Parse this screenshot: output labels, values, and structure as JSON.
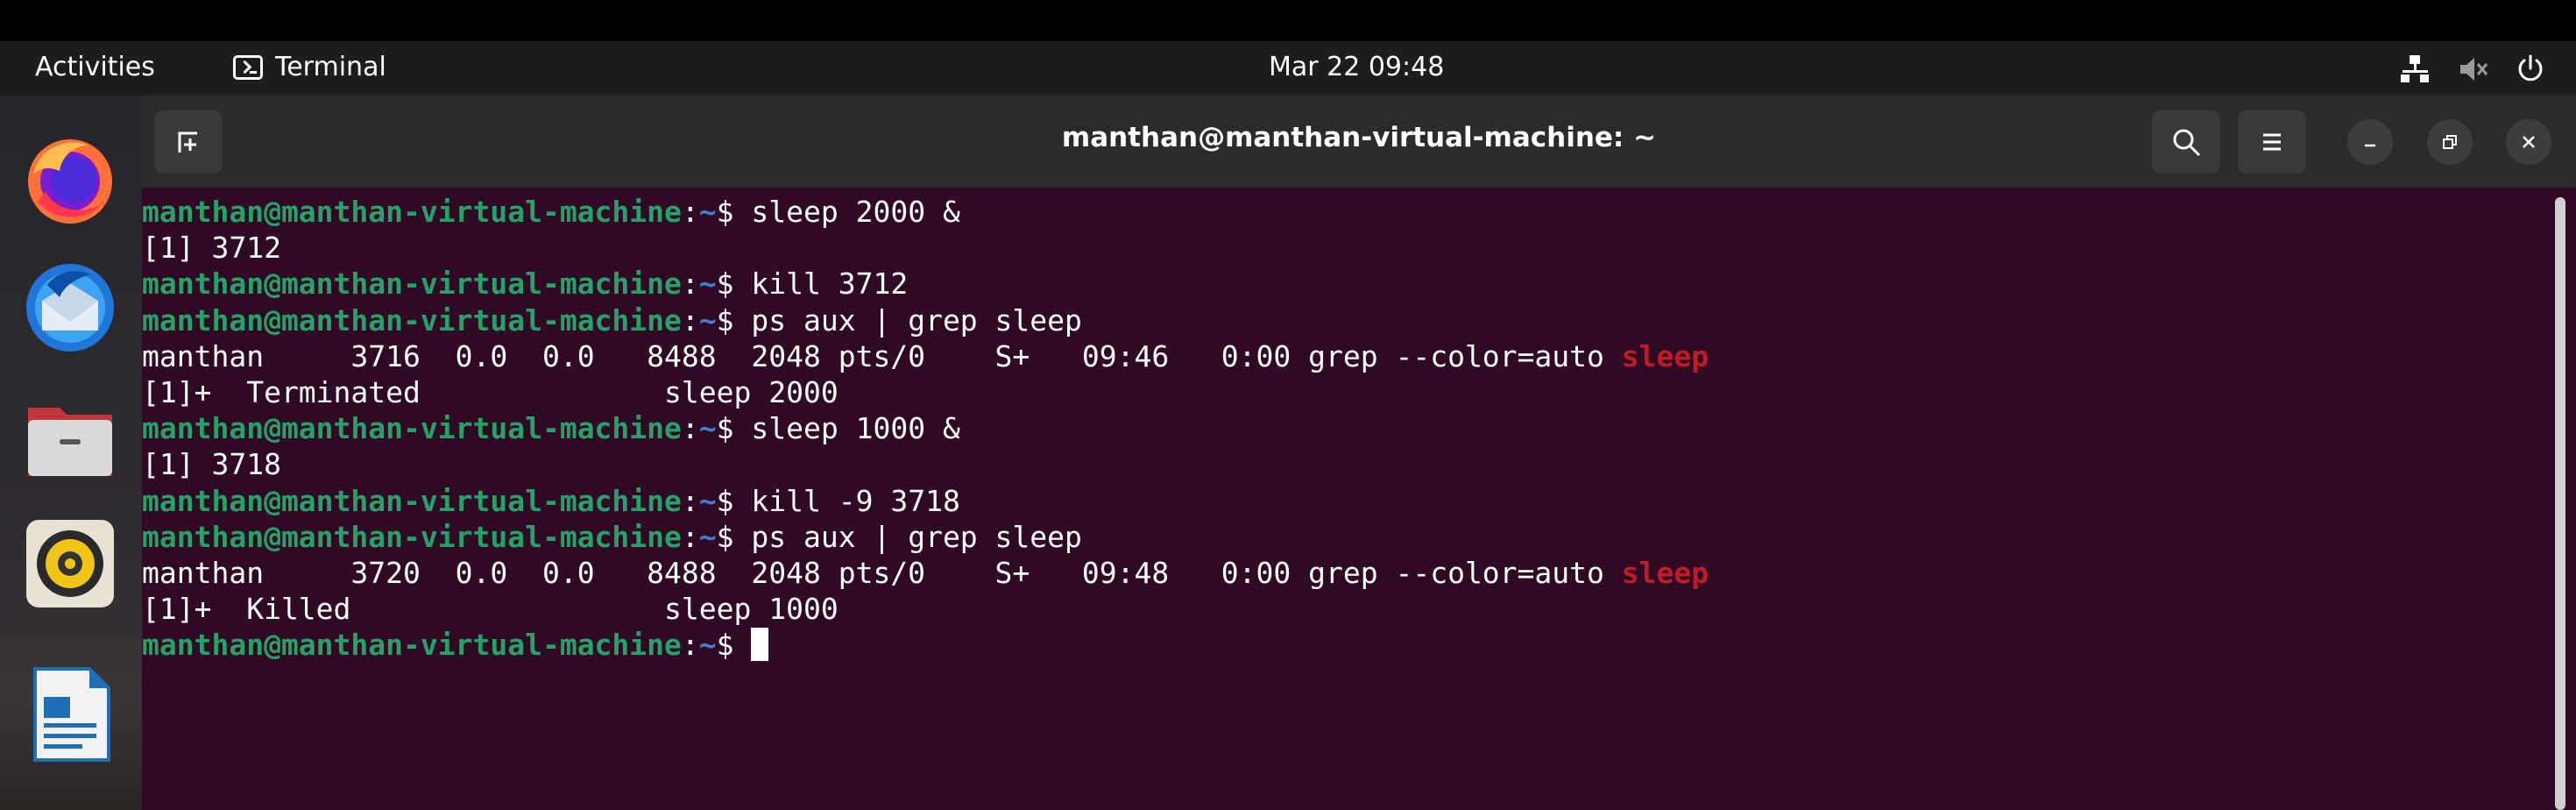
{
  "topbar": {
    "activities": "Activities",
    "app_name": "Terminal",
    "clock": "Mar 22  09:48"
  },
  "dock": {
    "items": [
      "firefox",
      "thunderbird",
      "files",
      "rhythmbox",
      "libreoffice-writer"
    ]
  },
  "window": {
    "title": "manthan@manthan-virtual-machine: ~"
  },
  "terminal": {
    "prompt_user_host": "manthan@manthan-virtual-machine",
    "prompt_path": "~",
    "prompt_symbol": "$",
    "lines": [
      {
        "type": "cmd",
        "text": " sleep 2000 &"
      },
      {
        "type": "out",
        "text": "[1] 3712"
      },
      {
        "type": "cmd",
        "text": " kill 3712"
      },
      {
        "type": "cmd",
        "text": " ps aux | grep sleep"
      },
      {
        "type": "grep",
        "text": "manthan     3716  0.0  0.0   8488  2048 pts/0    S+   09:46   0:00 grep --color=auto ",
        "match": "sleep"
      },
      {
        "type": "out",
        "text": "[1]+  Terminated              sleep 2000"
      },
      {
        "type": "cmd",
        "text": " sleep 1000 &"
      },
      {
        "type": "out",
        "text": "[1] 3718"
      },
      {
        "type": "cmd",
        "text": " kill -9 3718"
      },
      {
        "type": "cmd",
        "text": " ps aux | grep sleep"
      },
      {
        "type": "grep",
        "text": "manthan     3720  0.0  0.0   8488  2048 pts/0    S+   09:48   0:00 grep --color=auto ",
        "match": "sleep"
      },
      {
        "type": "out",
        "text": "[1]+  Killed                  sleep 1000"
      },
      {
        "type": "cmd",
        "text": " ",
        "cursor": true
      }
    ]
  },
  "colors": {
    "terminal_bg": "#300a24",
    "prompt_green": "#26a269",
    "path_blue": "#3f7fcf",
    "grep_match_red": "#c01c28",
    "headerbar": "#2b2b2b"
  }
}
